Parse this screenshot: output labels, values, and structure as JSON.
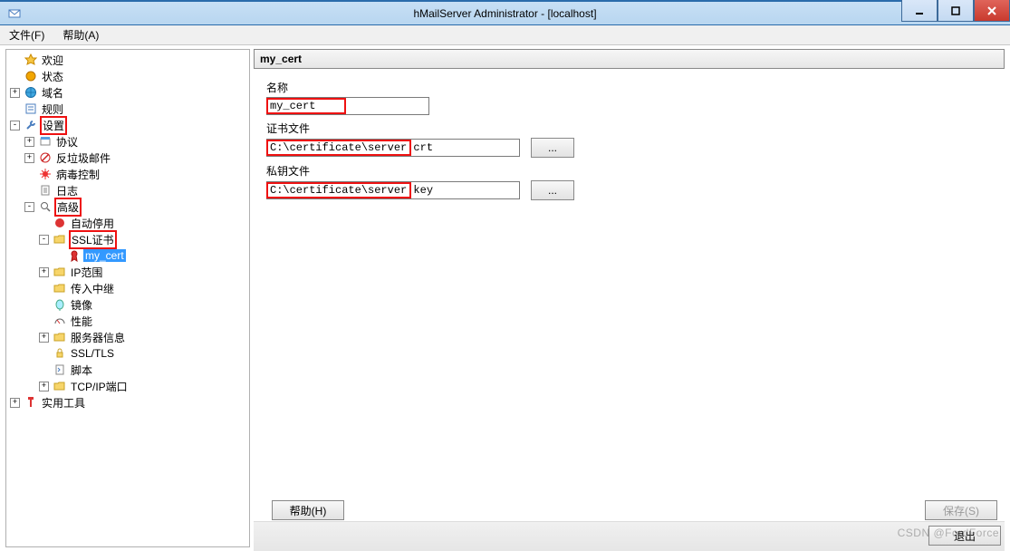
{
  "window": {
    "title": "hMailServer Administrator - [localhost]"
  },
  "menu": {
    "file": "文件(F)",
    "help": "帮助(A)"
  },
  "tree": {
    "welcome": "欢迎",
    "status": "状态",
    "domains": "域名",
    "rules": "规则",
    "settings": "设置",
    "protocols": "协议",
    "antispam": "反垃圾邮件",
    "antivirus": "病毒控制",
    "log": "日志",
    "advanced": "高级",
    "autoban": "自动停用",
    "sslcerts": "SSL证书",
    "mycert": "my_cert",
    "ipranges": "IP范围",
    "incomingrelays": "传入中继",
    "mirror": "镜像",
    "performance": "性能",
    "serverinfo": "服务器信息",
    "ssltls": "SSL/TLS",
    "scripts": "脚本",
    "tcpipports": "TCP/IP端口",
    "utilities": "实用工具"
  },
  "panel": {
    "title": "my_cert",
    "label_name": "名称",
    "value_name": "my_cert",
    "label_certfile": "证书文件",
    "value_certfile": "C:\\certificate\\server.crt",
    "label_keyfile": "私钥文件",
    "value_keyfile": "C:\\certificate\\server.key",
    "browse": "...",
    "help": "帮助(H)",
    "save": "保存(S)",
    "exit": "退出"
  },
  "watermark": "CSDN @FordForce"
}
